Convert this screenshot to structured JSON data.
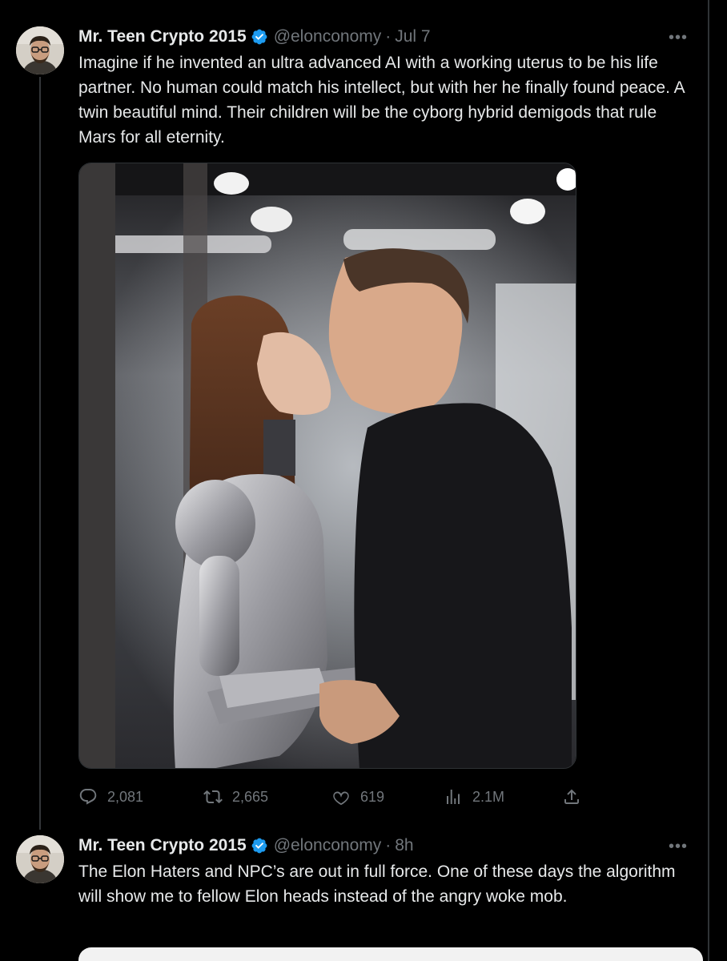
{
  "colors": {
    "background": "#000000",
    "text_primary": "#e7e9ea",
    "text_secondary": "#71767b",
    "verified_badge": "#1d9bf0",
    "divider": "#2f3336"
  },
  "tweets": [
    {
      "display_name": "Mr. Teen Crypto 2015",
      "handle": "@elonconomy",
      "separator": "·",
      "time": "Jul 7",
      "more_icon": "more-horizontal-icon",
      "text": "Imagine if he invented an ultra advanced AI with a working uterus to be his life partner. No human could match his intellect, but with her he finally found peace. A twin beautiful mind. Their children will be the cyborg hybrid demigods that rule Mars for all eternity.",
      "media_description": "photo",
      "stats": {
        "replies": "2,081",
        "retweets": "2,665",
        "likes": "619",
        "views": "2.1M"
      },
      "action_icons": [
        "reply-icon",
        "retweet-icon",
        "like-icon",
        "views-icon",
        "share-icon"
      ]
    },
    {
      "display_name": "Mr. Teen Crypto 2015",
      "handle": "@elonconomy",
      "separator": "·",
      "time": "8h",
      "more_icon": "more-horizontal-icon",
      "text": "The Elon Haters and NPC’s are out in full force. One of these days the algorithm will show me to fellow Elon heads instead of the angry woke mob."
    }
  ]
}
